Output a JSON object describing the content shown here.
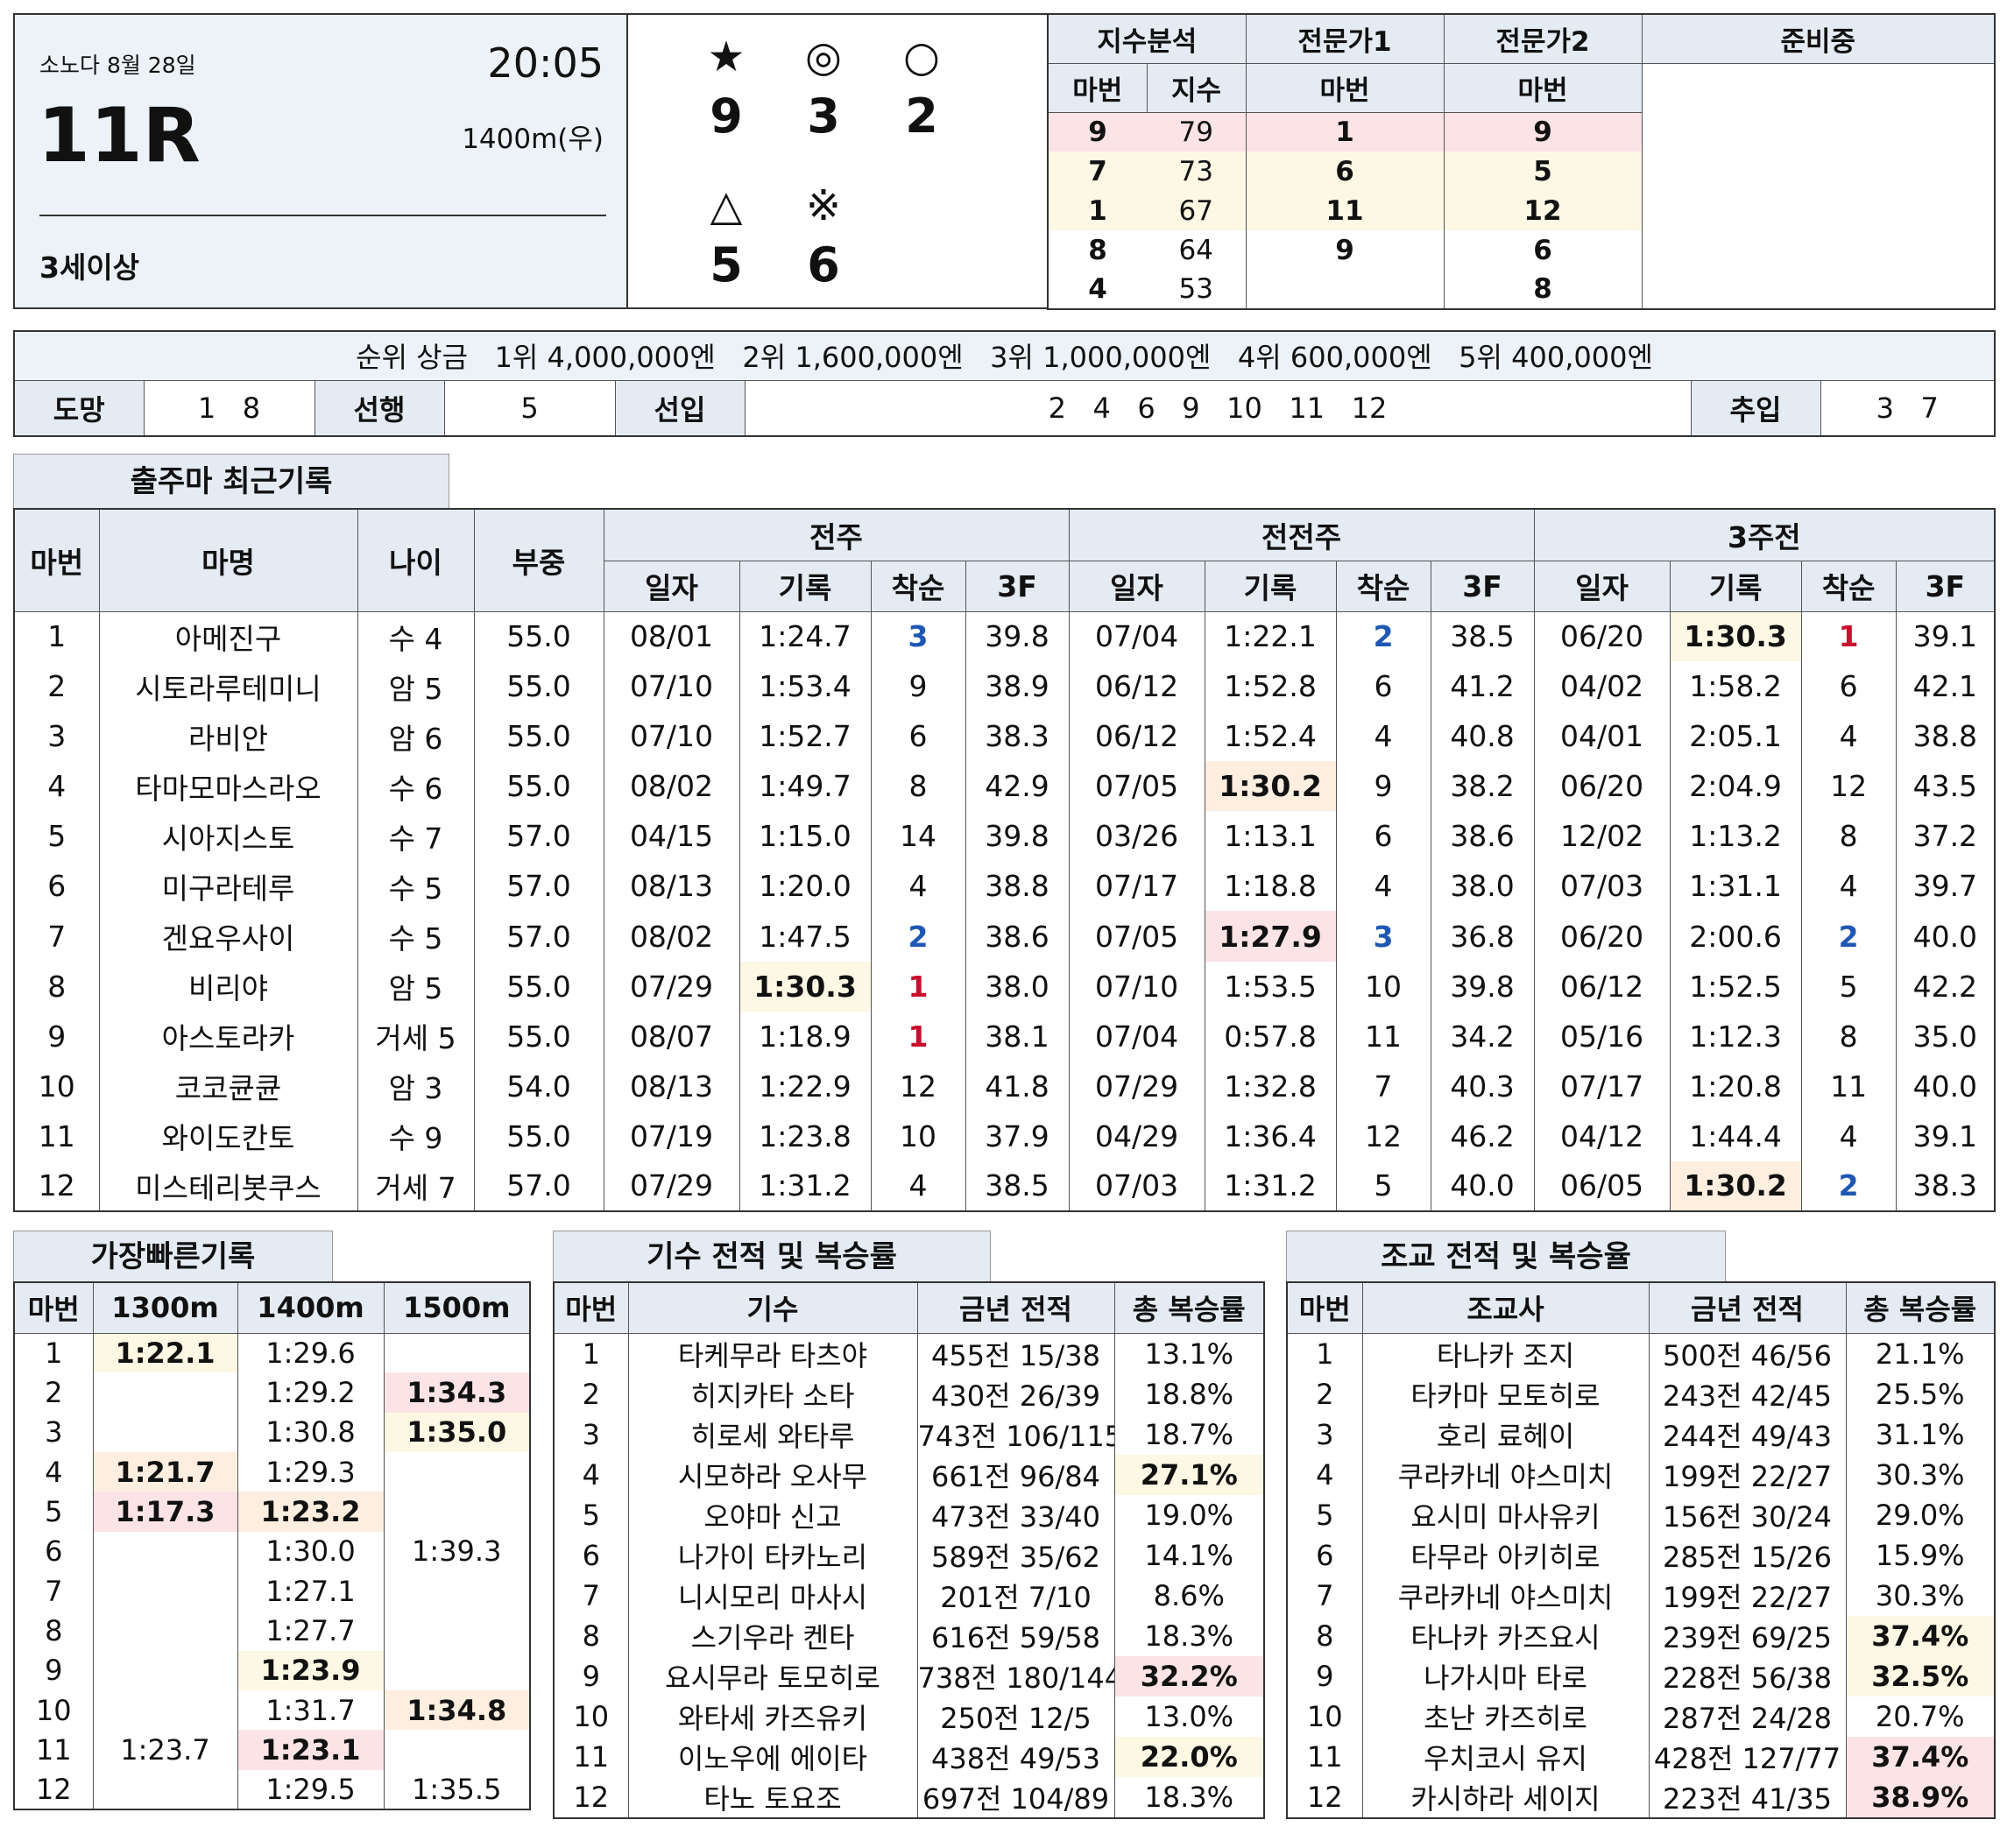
{
  "race": {
    "venue_date": "소노다 8월 28일",
    "time": "20:05",
    "race_no": "11R",
    "distance": "1400m(우)",
    "condition": "3세이상"
  },
  "marks": [
    {
      "symbol": "★",
      "number": "9"
    },
    {
      "symbol": "◎",
      "number": "3"
    },
    {
      "symbol": "○",
      "number": "2"
    },
    {
      "symbol": "△",
      "number": "5"
    },
    {
      "symbol": "※",
      "number": "6"
    }
  ],
  "analysis": {
    "headers": [
      "지수분석",
      "전문가1",
      "전문가2",
      "준비중"
    ],
    "subheaders": [
      "마번",
      "지수",
      "마번",
      "마번"
    ],
    "rows": [
      [
        "9",
        "79",
        "1",
        "9"
      ],
      [
        "7",
        "73",
        "6",
        "5"
      ],
      [
        "1",
        "67",
        "11",
        "12"
      ],
      [
        "8",
        "64",
        "9",
        "6"
      ],
      [
        "4",
        "53",
        "",
        "8"
      ]
    ]
  },
  "prize": "순위 상금   1위 4,000,000엔   2위 1,600,000엔   3위 1,000,000엔   4위 600,000엔   5위 400,000엔",
  "styles": {
    "escape_label": "도망",
    "escape": "1   8",
    "lead_label": "선행",
    "lead": "5",
    "stalk_label": "선입",
    "stalk": "2   4   6   9   10   11   12",
    "closer_label": "추입",
    "closer": "3   7"
  },
  "recent": {
    "tab": "출주마 최근기록",
    "headers": {
      "no": "마번",
      "name": "마명",
      "age": "나이",
      "weight": "부중",
      "w1": "전주",
      "w2": "전전주",
      "w3": "3주전",
      "date": "일자",
      "record": "기록",
      "place": "착순",
      "f3": "3F"
    },
    "rows": [
      [
        "1",
        "아메진구",
        "수 4",
        "55.0",
        "08/01",
        "1:24.7",
        "3",
        "39.8",
        "07/04",
        "1:22.1",
        "2",
        "38.5",
        "06/20",
        "1:30.3",
        "1",
        "39.1"
      ],
      [
        "2",
        "시토라루테미니",
        "암 5",
        "55.0",
        "07/10",
        "1:53.4",
        "9",
        "38.9",
        "06/12",
        "1:52.8",
        "6",
        "41.2",
        "04/02",
        "1:58.2",
        "6",
        "42.1"
      ],
      [
        "3",
        "라비안",
        "암 6",
        "55.0",
        "07/10",
        "1:52.7",
        "6",
        "38.3",
        "06/12",
        "1:52.4",
        "4",
        "40.8",
        "04/01",
        "2:05.1",
        "4",
        "38.8"
      ],
      [
        "4",
        "타마모마스라오",
        "수 6",
        "55.0",
        "08/02",
        "1:49.7",
        "8",
        "42.9",
        "07/05",
        "1:30.2",
        "9",
        "38.2",
        "06/20",
        "2:04.9",
        "12",
        "43.5"
      ],
      [
        "5",
        "시아지스토",
        "수 7",
        "57.0",
        "04/15",
        "1:15.0",
        "14",
        "39.8",
        "03/26",
        "1:13.1",
        "6",
        "38.6",
        "12/02",
        "1:13.2",
        "8",
        "37.2"
      ],
      [
        "6",
        "미구라테루",
        "수 5",
        "57.0",
        "08/13",
        "1:20.0",
        "4",
        "38.8",
        "07/17",
        "1:18.8",
        "4",
        "38.0",
        "07/03",
        "1:31.1",
        "4",
        "39.7"
      ],
      [
        "7",
        "겐요우사이",
        "수 5",
        "57.0",
        "08/02",
        "1:47.5",
        "2",
        "38.6",
        "07/05",
        "1:27.9",
        "3",
        "36.8",
        "06/20",
        "2:00.6",
        "2",
        "40.0"
      ],
      [
        "8",
        "비리야",
        "암 5",
        "55.0",
        "07/29",
        "1:30.3",
        "1",
        "38.0",
        "07/10",
        "1:53.5",
        "10",
        "39.8",
        "06/12",
        "1:52.5",
        "5",
        "42.2"
      ],
      [
        "9",
        "아스토라카",
        "거세 5",
        "55.0",
        "08/07",
        "1:18.9",
        "1",
        "38.1",
        "07/04",
        "0:57.8",
        "11",
        "34.2",
        "05/16",
        "1:12.3",
        "8",
        "35.0"
      ],
      [
        "10",
        "코코큔큔",
        "암 3",
        "54.0",
        "08/13",
        "1:22.9",
        "12",
        "41.8",
        "07/29",
        "1:32.8",
        "7",
        "40.3",
        "07/17",
        "1:20.8",
        "11",
        "40.0"
      ],
      [
        "11",
        "와이도칸토",
        "수 9",
        "55.0",
        "07/19",
        "1:23.8",
        "10",
        "37.9",
        "04/29",
        "1:36.4",
        "12",
        "46.2",
        "04/12",
        "1:44.4",
        "4",
        "39.1"
      ],
      [
        "12",
        "미스테리봇쿠스",
        "거세 7",
        "57.0",
        "07/29",
        "1:31.2",
        "4",
        "38.5",
        "07/03",
        "1:31.2",
        "5",
        "40.0",
        "06/05",
        "1:30.2",
        "2",
        "38.3"
      ]
    ]
  },
  "fastest": {
    "tab": "가장빠른기록",
    "headers": [
      "마번",
      "1300m",
      "1400m",
      "1500m"
    ],
    "rows": [
      [
        "1",
        "1:22.1",
        "1:29.6",
        ""
      ],
      [
        "2",
        "",
        "1:29.2",
        "1:34.3"
      ],
      [
        "3",
        "",
        "1:30.8",
        "1:35.0"
      ],
      [
        "4",
        "1:21.7",
        "1:29.3",
        ""
      ],
      [
        "5",
        "1:17.3",
        "1:23.2",
        ""
      ],
      [
        "6",
        "",
        "1:30.0",
        "1:39.3"
      ],
      [
        "7",
        "",
        "1:27.1",
        ""
      ],
      [
        "8",
        "",
        "1:27.7",
        ""
      ],
      [
        "9",
        "",
        "1:23.9",
        ""
      ],
      [
        "10",
        "",
        "1:31.7",
        "1:34.8"
      ],
      [
        "11",
        "1:23.7",
        "1:23.1",
        ""
      ],
      [
        "12",
        "",
        "1:29.5",
        "1:35.5"
      ]
    ]
  },
  "jockey": {
    "tab": "기수 전적 및 복승률",
    "headers": [
      "마번",
      "기수",
      "금년 전적",
      "총 복승률"
    ],
    "rows": [
      [
        "1",
        "타케무라 타츠야",
        "455전 15/38",
        "13.1%"
      ],
      [
        "2",
        "히지카타 소타",
        "430전 26/39",
        "18.8%"
      ],
      [
        "3",
        "히로세 와타루",
        "743전 106/115",
        "18.7%"
      ],
      [
        "4",
        "시모하라 오사무",
        "661전 96/84",
        "27.1%"
      ],
      [
        "5",
        "오야마 신고",
        "473전 33/40",
        "19.0%"
      ],
      [
        "6",
        "나가이 타카노리",
        "589전 35/62",
        "14.1%"
      ],
      [
        "7",
        "니시모리 마사시",
        "201전 7/10",
        "8.6%"
      ],
      [
        "8",
        "스기우라 켄타",
        "616전 59/58",
        "18.3%"
      ],
      [
        "9",
        "요시무라 토모히로",
        "738전 180/144",
        "32.2%"
      ],
      [
        "10",
        "와타세 카즈유키",
        "250전 12/5",
        "13.0%"
      ],
      [
        "11",
        "이노우에 에이타",
        "438전 49/53",
        "22.0%"
      ],
      [
        "12",
        "타노 토요조",
        "697전 104/89",
        "18.3%"
      ]
    ]
  },
  "trainer": {
    "tab": "조교 전적 및 복승율",
    "headers": [
      "마번",
      "조교사",
      "금년 전적",
      "총 복승률"
    ],
    "rows": [
      [
        "1",
        "타나카 조지",
        "500전 46/56",
        "21.1%"
      ],
      [
        "2",
        "타카마 모토히로",
        "243전 42/45",
        "25.5%"
      ],
      [
        "3",
        "호리 료헤이",
        "244전 49/43",
        "31.1%"
      ],
      [
        "4",
        "쿠라카네 야스미치",
        "199전 22/27",
        "30.3%"
      ],
      [
        "5",
        "요시미 마사유키",
        "156전 30/24",
        "29.0%"
      ],
      [
        "6",
        "타무라 아키히로",
        "285전 15/26",
        "15.9%"
      ],
      [
        "7",
        "쿠라카네 야스미치",
        "199전 22/27",
        "30.3%"
      ],
      [
        "8",
        "타나카 카즈요시",
        "239전 69/25",
        "37.4%"
      ],
      [
        "9",
        "나가시마 타로",
        "228전 56/38",
        "32.5%"
      ],
      [
        "10",
        "초난 카즈히로",
        "287전 24/28",
        "20.7%"
      ],
      [
        "11",
        "우치코시 유지",
        "428전 127/77",
        "37.4%"
      ],
      [
        "12",
        "카시하라 세이지",
        "223전 41/35",
        "38.9%"
      ]
    ]
  }
}
